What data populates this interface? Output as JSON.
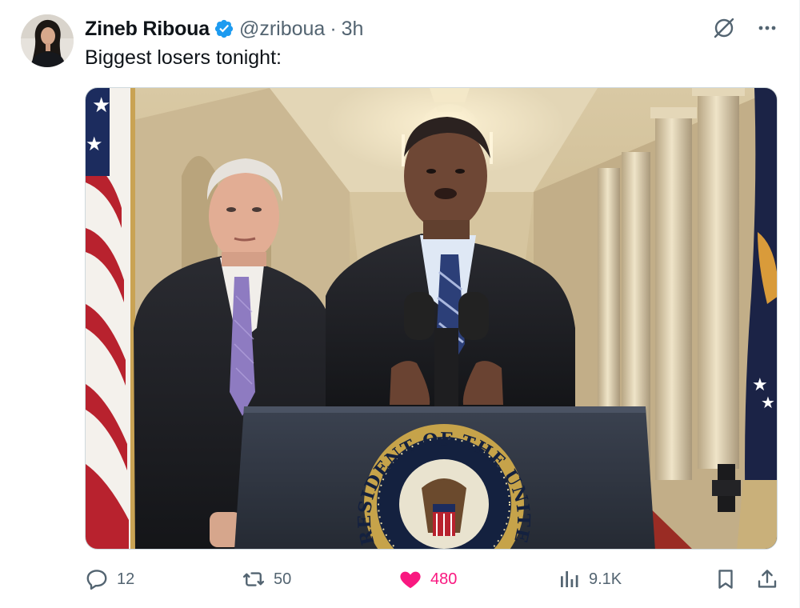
{
  "author": {
    "display_name": "Zineb Riboua",
    "handle": "@zriboua",
    "time": "3h",
    "separator": "·",
    "verified": true
  },
  "tweet": {
    "text": "Biggest losers tonight:"
  },
  "media": {
    "kind": "photo",
    "seal_text": "PRESIDENT OF THE UNITED"
  },
  "actions": {
    "replies": "12",
    "reposts": "50",
    "likes": "480",
    "views": "9.1K",
    "liked": true
  },
  "icons": {
    "reply": "reply-icon",
    "repost": "repost-icon",
    "like": "heart-icon",
    "views": "views-icon",
    "bookmark": "bookmark-icon",
    "share": "share-icon",
    "grok": "grok-icon",
    "more": "more-icon",
    "verified": "verified-badge-icon"
  },
  "colors": {
    "text": "#0f1419",
    "secondary": "#536471",
    "like": "#f91880",
    "verified": "#1d9bf0"
  }
}
